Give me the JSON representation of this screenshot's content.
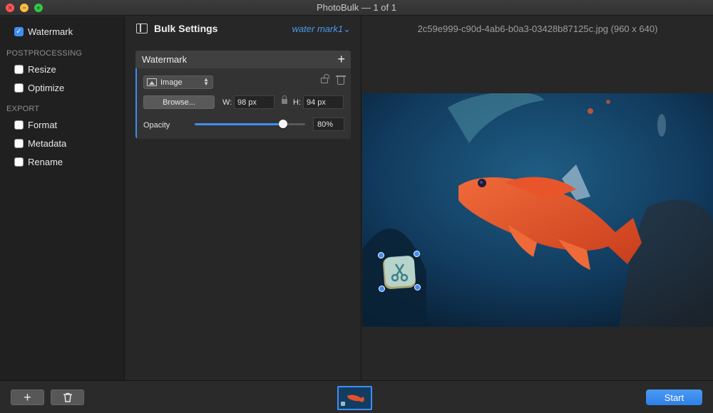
{
  "window": {
    "title": "PhotoBulk — 1 of 1",
    "controls": {
      "close_symbol": "✕",
      "minimize_symbol": "−",
      "maximize_symbol": "+"
    }
  },
  "sidebar": {
    "watermark": {
      "label": "Watermark",
      "checked": true
    },
    "sections": [
      {
        "heading": "POSTPROCESSING",
        "items": [
          {
            "label": "Resize",
            "checked": false
          },
          {
            "label": "Optimize",
            "checked": false
          }
        ]
      },
      {
        "heading": "EXPORT",
        "items": [
          {
            "label": "Format",
            "checked": false
          },
          {
            "label": "Metadata",
            "checked": false
          },
          {
            "label": "Rename",
            "checked": false
          }
        ]
      }
    ]
  },
  "settings": {
    "title": "Bulk Settings",
    "preset": "water mark1",
    "preset_chevron": "⌄",
    "watermark_card": {
      "title": "Watermark",
      "add_symbol": "+",
      "type": "Image",
      "browse_label": "Browse...",
      "width_label": "W:",
      "width_value": "98 px",
      "height_label": "H:",
      "height_value": "94 px",
      "opacity_label": "Opacity",
      "opacity_value": "80%",
      "opacity_fraction": 0.8
    }
  },
  "preview": {
    "filename": "2c59e999-c90d-4ab6-b0a3-03428b87125c.jpg (960 x 640)"
  },
  "bottom": {
    "add_symbol": "+",
    "start_label": "Start"
  },
  "colors": {
    "accent": "#3d8ef4",
    "fish": "#e4502a",
    "water": "#0f2c47"
  }
}
